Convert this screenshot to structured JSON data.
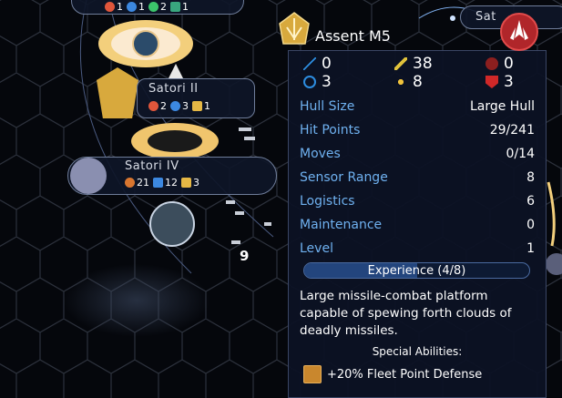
{
  "map": {
    "top_planet": {
      "stats": [
        "1",
        "1",
        "2",
        "1"
      ]
    },
    "satori2": {
      "name": "Satori II",
      "stats": [
        "2",
        "3",
        "1"
      ]
    },
    "satori4": {
      "name": "Satori IV",
      "stats": [
        "21",
        "12",
        "3"
      ]
    },
    "edge_label": "Sat",
    "fleet_count": "9"
  },
  "tooltip": {
    "ship_name": "Assent M5",
    "combat": {
      "beam_attack": "0",
      "missile_attack": "38",
      "kinetic_attack": "0",
      "shield": "3",
      "point_defense": "8",
      "armor": "3"
    },
    "rows": [
      {
        "label": "Hull Size",
        "value": "Large Hull"
      },
      {
        "label": "Hit Points",
        "value": "29/241"
      },
      {
        "label": "Moves",
        "value": "0/14"
      },
      {
        "label": "Sensor Range",
        "value": "8"
      },
      {
        "label": "Logistics",
        "value": "6"
      },
      {
        "label": "Maintenance",
        "value": "0"
      },
      {
        "label": "Level",
        "value": "1"
      }
    ],
    "experience": {
      "label": "Experience (4/8)",
      "fraction": 0.5
    },
    "description": "Large missile-combat platform capable of spewing forth clouds of deadly missiles.",
    "abilities_title": "Special Abilities:",
    "abilities": [
      {
        "label": "+20% Fleet Point Defense",
        "icon": "point-defense-icon"
      }
    ]
  },
  "colors": {
    "label_blue": "#6fb1f0",
    "faction_red": "#b0262a",
    "panel": "#0c1224"
  }
}
